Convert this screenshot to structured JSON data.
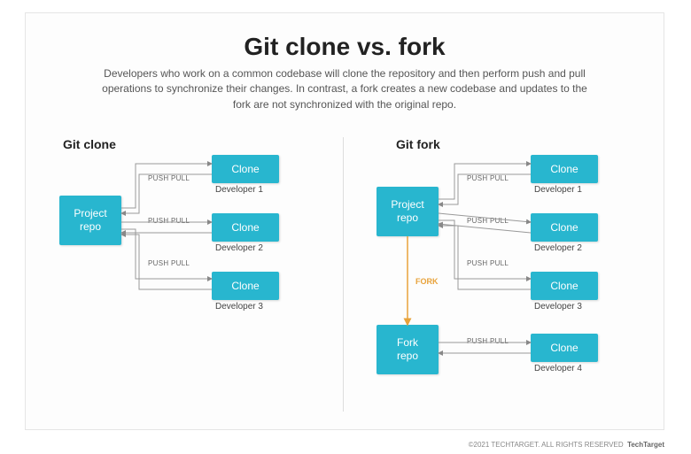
{
  "title": "Git clone vs. fork",
  "subtitle": "Developers who work on a common codebase will clone the repository and then perform push and pull operations to synchronize their changes. In contrast, a fork creates a new codebase and updates to the fork are not synchronized with the original repo.",
  "left": {
    "label": "Git clone",
    "repo": "Project\nrepo",
    "edge": "PUSH PULL",
    "clones": [
      {
        "box": "Clone",
        "cap": "Developer 1"
      },
      {
        "box": "Clone",
        "cap": "Developer 2"
      },
      {
        "box": "Clone",
        "cap": "Developer 3"
      }
    ]
  },
  "right": {
    "label": "Git fork",
    "repo": "Project\nrepo",
    "forkRepo": "Fork\nrepo",
    "edge": "PUSH PULL",
    "forkEdge": "FORK",
    "clones": [
      {
        "box": "Clone",
        "cap": "Developer 1"
      },
      {
        "box": "Clone",
        "cap": "Developer 2"
      },
      {
        "box": "Clone",
        "cap": "Developer 3"
      },
      {
        "box": "Clone",
        "cap": "Developer 4"
      }
    ]
  },
  "footer": {
    "copy": "©2021 TECHTARGET. ALL RIGHTS RESERVED",
    "brand": "TechTarget"
  }
}
